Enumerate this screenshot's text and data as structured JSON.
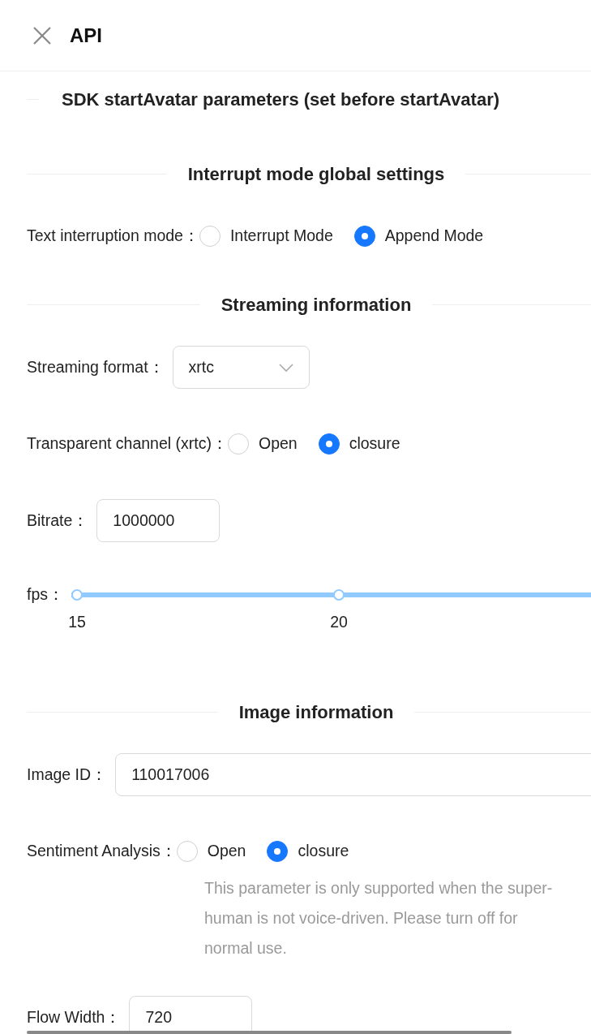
{
  "header": {
    "title": "API"
  },
  "main_title": "SDK startAvatar parameters (set before startAvatar)",
  "sections": [
    {
      "title": "Interrupt mode global settings",
      "fields": [
        {
          "kind": "radio",
          "label": "Text interruption mode：",
          "options": [
            {
              "label": "Interrupt Mode",
              "selected": false
            },
            {
              "label": "Append Mode",
              "selected": true
            }
          ]
        }
      ]
    },
    {
      "title": "Streaming information",
      "fields": [
        {
          "kind": "select",
          "label": "Streaming format：",
          "value": "xrtc"
        },
        {
          "kind": "radio",
          "label": "Transparent channel (xrtc)：",
          "options": [
            {
              "label": "Open",
              "selected": false
            },
            {
              "label": "closure",
              "selected": true
            }
          ]
        },
        {
          "kind": "input",
          "label": "Bitrate：",
          "value": "1000000"
        },
        {
          "kind": "slider",
          "label": "fps：",
          "marks": [
            "15",
            "20"
          ]
        }
      ]
    },
    {
      "title": "Image information",
      "fields": [
        {
          "kind": "input",
          "label": "Image ID：",
          "value": "110017006",
          "wide": true
        },
        {
          "kind": "radio",
          "label": "Sentiment Analysis：",
          "options": [
            {
              "label": "Open",
              "selected": false
            },
            {
              "label": "closure",
              "selected": true
            }
          ],
          "help": "This parameter is only supported when the super-human is not voice-driven. Please turn off for normal use."
        },
        {
          "kind": "input",
          "label": "Flow Width：",
          "value": "720"
        }
      ]
    }
  ]
}
